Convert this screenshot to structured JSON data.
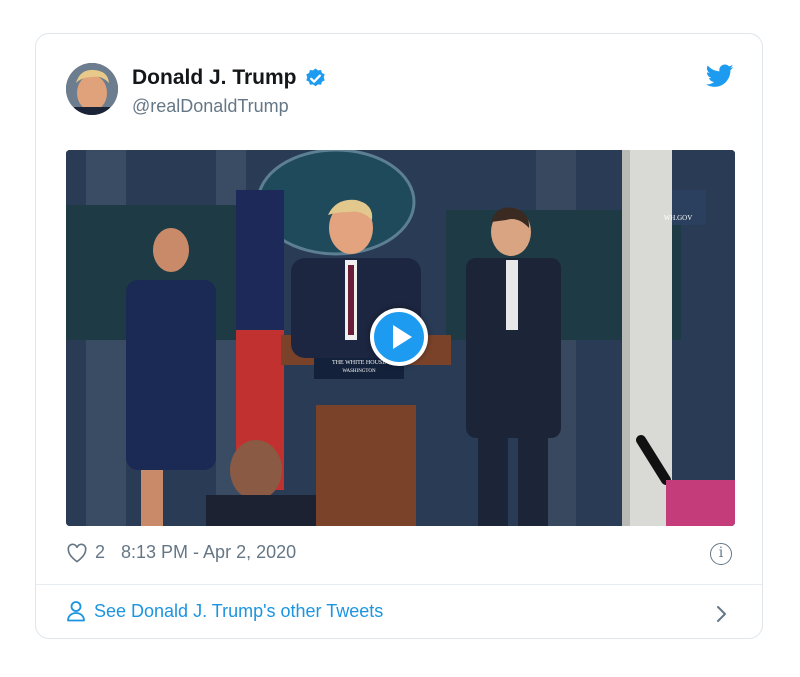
{
  "tweet": {
    "author_name": "Donald J. Trump",
    "handle": "@realDonaldTrump",
    "likes": "2",
    "timestamp": "8:13 PM - Apr 2, 2020",
    "other_tweets_label": "See Donald J. Trump's other Tweets"
  },
  "media": {
    "type": "video",
    "podium_sign_line1": "THE WHITE HOUSE",
    "podium_sign_line2": "WASHINGTON",
    "screen_watermark": "WH.GOV"
  },
  "icons": {
    "verified": "verified-badge-icon",
    "brand": "twitter-bird-icon",
    "like": "heart-icon",
    "info": "info-icon",
    "profile": "person-icon",
    "next": "chevron-right-icon",
    "play": "play-icon"
  },
  "colors": {
    "brand_blue": "#1d9bf0",
    "link_blue": "#1b95e0",
    "text_primary": "#14171a",
    "text_secondary": "#657786",
    "border": "#dfe5ea"
  }
}
